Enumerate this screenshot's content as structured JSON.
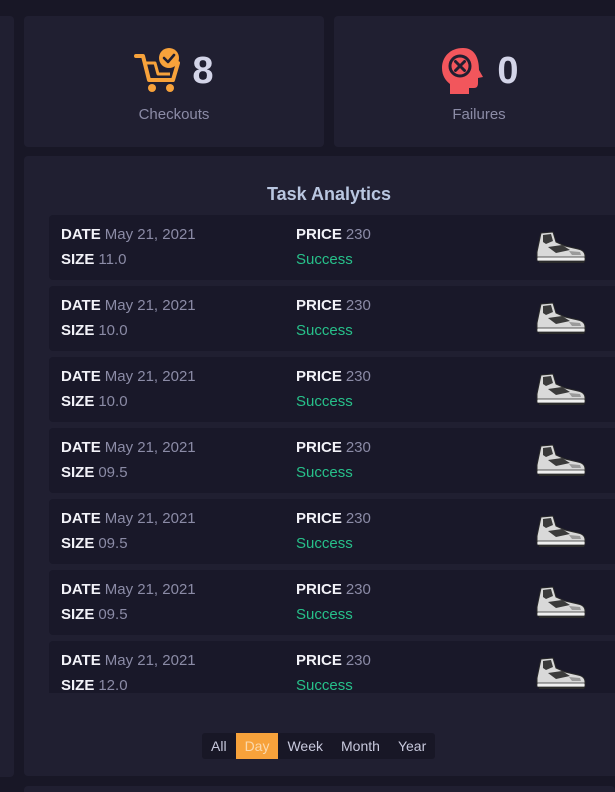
{
  "colors": {
    "accent": "#f7a23b",
    "checkout_icon": "#f7a23b",
    "failure_icon": "#f2565c",
    "success": "#27c08a"
  },
  "stats": {
    "checkouts": {
      "icon": "shopping-cart-check-icon",
      "value": "8",
      "label": "Checkouts"
    },
    "failures": {
      "icon": "head-x-icon",
      "value": "0",
      "label": "Failures"
    }
  },
  "analytics": {
    "title": "Task Analytics",
    "labels": {
      "date": "DATE",
      "size": "SIZE",
      "price": "PRICE"
    },
    "rows": [
      {
        "date": "May 21, 2021",
        "size": "11.0",
        "price": "230",
        "status": "Success",
        "icon": "sneaker-icon"
      },
      {
        "date": "May 21, 2021",
        "size": "10.0",
        "price": "230",
        "status": "Success",
        "icon": "sneaker-icon"
      },
      {
        "date": "May 21, 2021",
        "size": "10.0",
        "price": "230",
        "status": "Success",
        "icon": "sneaker-icon"
      },
      {
        "date": "May 21, 2021",
        "size": "09.5",
        "price": "230",
        "status": "Success",
        "icon": "sneaker-icon"
      },
      {
        "date": "May 21, 2021",
        "size": "09.5",
        "price": "230",
        "status": "Success",
        "icon": "sneaker-icon"
      },
      {
        "date": "May 21, 2021",
        "size": "09.5",
        "price": "230",
        "status": "Success",
        "icon": "sneaker-icon"
      },
      {
        "date": "May 21, 2021",
        "size": "12.0",
        "price": "230",
        "status": "Success",
        "icon": "sneaker-icon"
      }
    ]
  },
  "filters": {
    "options": [
      "All",
      "Day",
      "Week",
      "Month",
      "Year"
    ],
    "selected": "Day"
  }
}
